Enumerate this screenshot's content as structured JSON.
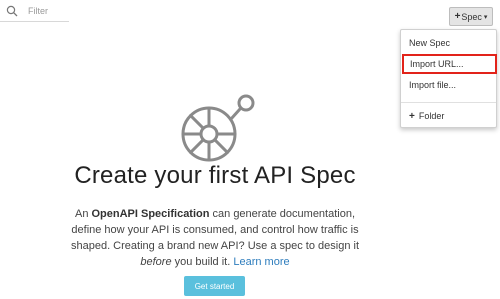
{
  "filter": {
    "placeholder": "Filter",
    "icon": "search-icon"
  },
  "spec_button": {
    "plus": "+",
    "label": "Spec",
    "caret": "▾"
  },
  "dropdown": {
    "items": [
      {
        "label": "New Spec"
      },
      {
        "label": "Import URL..."
      },
      {
        "label": "Import file..."
      },
      {
        "label": "Folder",
        "prefix": "+"
      }
    ],
    "highlight_color": "#e2231a"
  },
  "empty_state": {
    "logo_icon": "openapi-logo-icon",
    "headline": "Create your first API Spec",
    "desc_part1": "An ",
    "desc_bold": "OpenAPI Specification",
    "desc_part2": " can generate documentation, define how your API is consumed, and control how traffic is shaped. Creating a brand new API? Use a spec to design it ",
    "desc_italic": "before",
    "desc_part3": " you build it. ",
    "desc_link": "Learn more",
    "button_label": "Get started"
  },
  "colors": {
    "accent": "#5ac0dd",
    "link": "#2e7dbd",
    "logo": "#8a8a8a"
  }
}
